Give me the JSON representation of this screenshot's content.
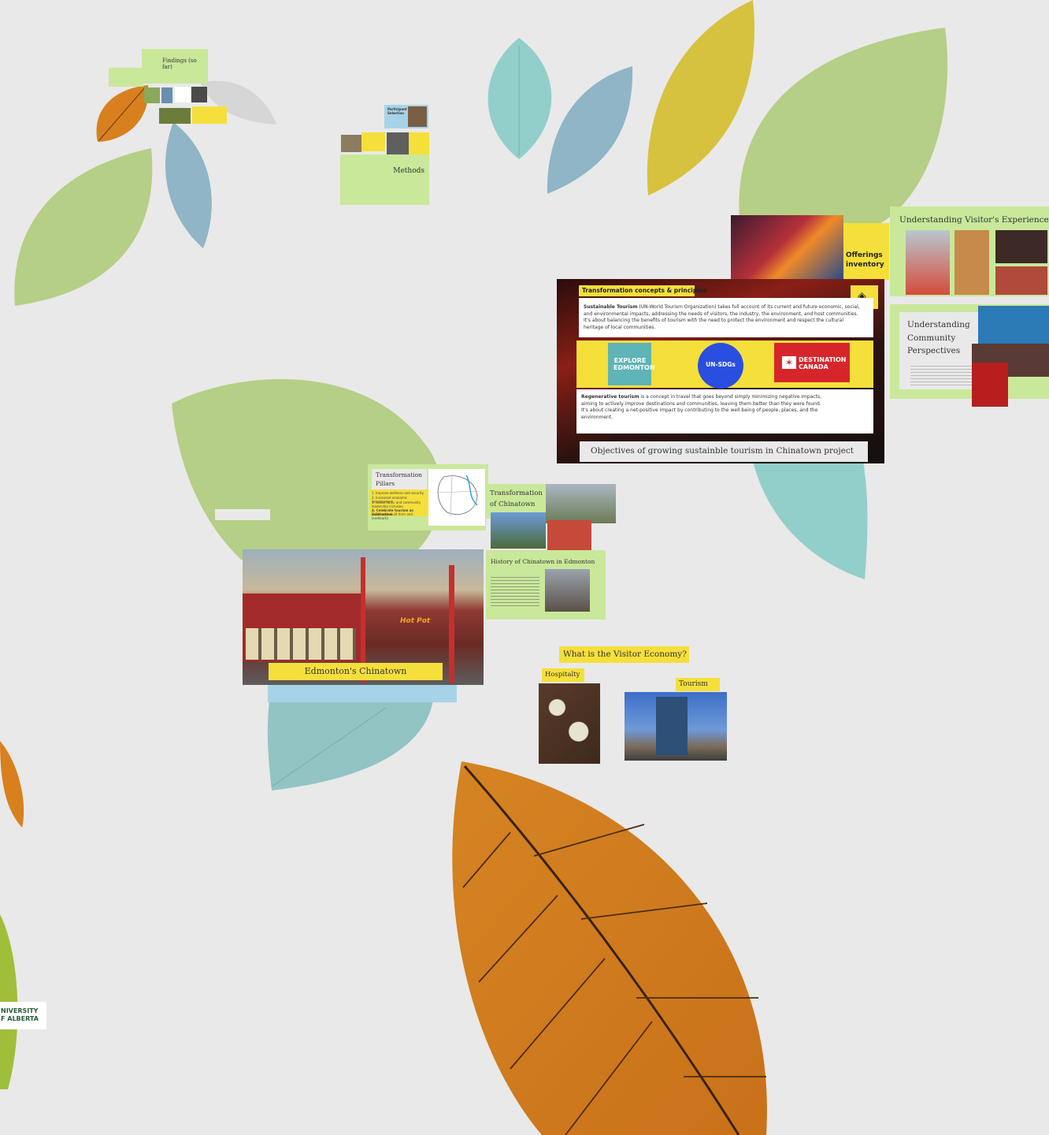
{
  "canvas": {
    "background": "#e9e9e9",
    "colors": {
      "card_green": "#c9e89a",
      "card_yellow": "#f5df3b",
      "leaf_green": "#b5cf86",
      "leaf_blue": "#8fb5c6",
      "leaf_teal": "#92cfca",
      "leaf_orange": "#d8801e",
      "leaf_mustard": "#d6c23e",
      "light_blue": "#a7d3e8"
    }
  },
  "findings": {
    "title": "Findings (so far)"
  },
  "methods": {
    "title": "Methods",
    "participant_selection": "Participant Selection"
  },
  "offerings": {
    "title": "Offerings inventory"
  },
  "visitors": {
    "title": "Understanding Visitor's Experiences"
  },
  "community": {
    "title": "Understanding Community Perspectives"
  },
  "objectives": {
    "header": "Transformation concepts & principles",
    "sustainable_term": "Sustainable Tourism",
    "sustainable_text": "(UN-World Tourism Organization) takes full account of its current and future economic, social, and environmental impacts, addressing the needs of visitors, the industry, the environment, and host communities. It's about balancing the benefits of tourism with the need to protect the environment and respect the cultural heritage of local communities.",
    "logo_explore": "EXPLORE EDMONTON",
    "logo_sdg": "UN-SDGs",
    "logo_destination": "DESTINATION CANADA",
    "regenerative_term": "Regenerative tourism",
    "regenerative_text": "is a concept in travel that goes beyond simply minimizing negative impacts, aiming to actively improve destinations and communities, leaving them better than they were found. It's about creating a net-positive impact by contributing to the well-being of people, places, and the environment.",
    "footer": "Objectives of growing sustainble tourism in Chinatown project"
  },
  "pillars": {
    "title": "Transformation Pillars",
    "items": [
      "1. Improve wellness and security",
      "2. Increased economic development",
      "3. Social fabric and community leadership inclusion",
      "4. Celebrate tourism as destination",
      "5. Enhance built form and landmarks"
    ]
  },
  "transformation": {
    "title": "Transformation of Chinatown"
  },
  "history": {
    "title": "History of Chinatown in Edmonton"
  },
  "chinatown": {
    "title": "Edmonton's Chinatown",
    "sign_hotpot": "Hot Pot"
  },
  "visitor_economy": {
    "title": "What is the Visitor Economy?",
    "hospitality": "Hospitalty",
    "tourism": "Tourism"
  },
  "university": {
    "line1": "NIVERSITY",
    "line2": "F ALBERTA"
  }
}
